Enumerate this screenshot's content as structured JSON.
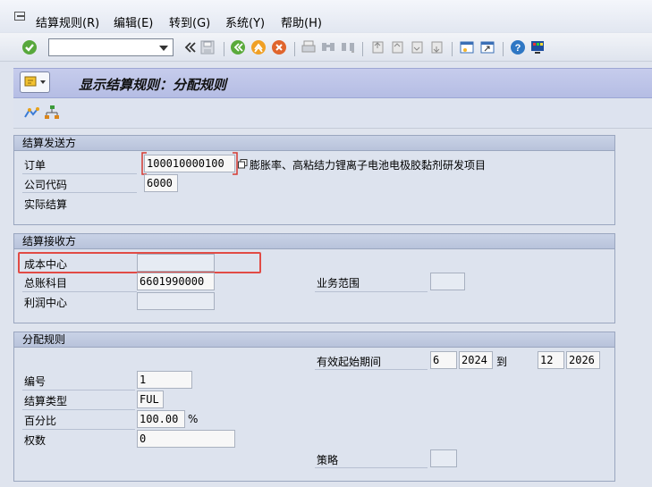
{
  "menu": [
    "结算规则(R)",
    "编辑(E)",
    "转到(G)",
    "系统(Y)",
    "帮助(H)"
  ],
  "page": {
    "title": "显示结算规则：分配规则"
  },
  "sender": {
    "title": "结算发送方",
    "order_label": "订单",
    "order_value": "100010000100",
    "order_desc": "膨胀率、高粘结力锂离子电池电极胶黏剂研发项目",
    "company_label": "公司代码",
    "company_value": "6000",
    "actual_label": "实际结算"
  },
  "receiver": {
    "title": "结算接收方",
    "cost_center_label": "成本中心",
    "cost_center_value": "",
    "gl_label": "总账科目",
    "gl_value": "6601990000",
    "profit_center_label": "利润中心",
    "profit_center_value": "",
    "business_area_label": "业务范围",
    "business_area_value": ""
  },
  "rule": {
    "title": "分配规则",
    "validity_label": "有效起始期间",
    "from_period": "6",
    "from_year": "2024",
    "to_label": "到",
    "to_period": "12",
    "to_year": "2026",
    "number_label": "编号",
    "number_value": "1",
    "type_label": "结算类型",
    "type_value": "FUL",
    "percent_label": "百分比",
    "percent_value": "100.00",
    "percent_sign": "%",
    "weight_label": "权数",
    "weight_value": "0",
    "strategy_label": "策略",
    "strategy_value": ""
  },
  "icons": [
    "menu-icon",
    "check-icon",
    "dropdown-icon",
    "history-icon",
    "save-icon",
    "back-icon",
    "exit-icon",
    "cancel-icon",
    "print-icon",
    "find-icon",
    "find-next-icon",
    "first-page-icon",
    "prev-page-icon",
    "next-page-icon",
    "last-page-icon",
    "new-window-icon",
    "shortcut-icon",
    "help-icon",
    "layout-icon",
    "title-action-icon",
    "hierarchy-icon",
    "tree-icon"
  ],
  "colors": {
    "titlebar": "#b5bde4",
    "highlight": "#e14b45"
  }
}
